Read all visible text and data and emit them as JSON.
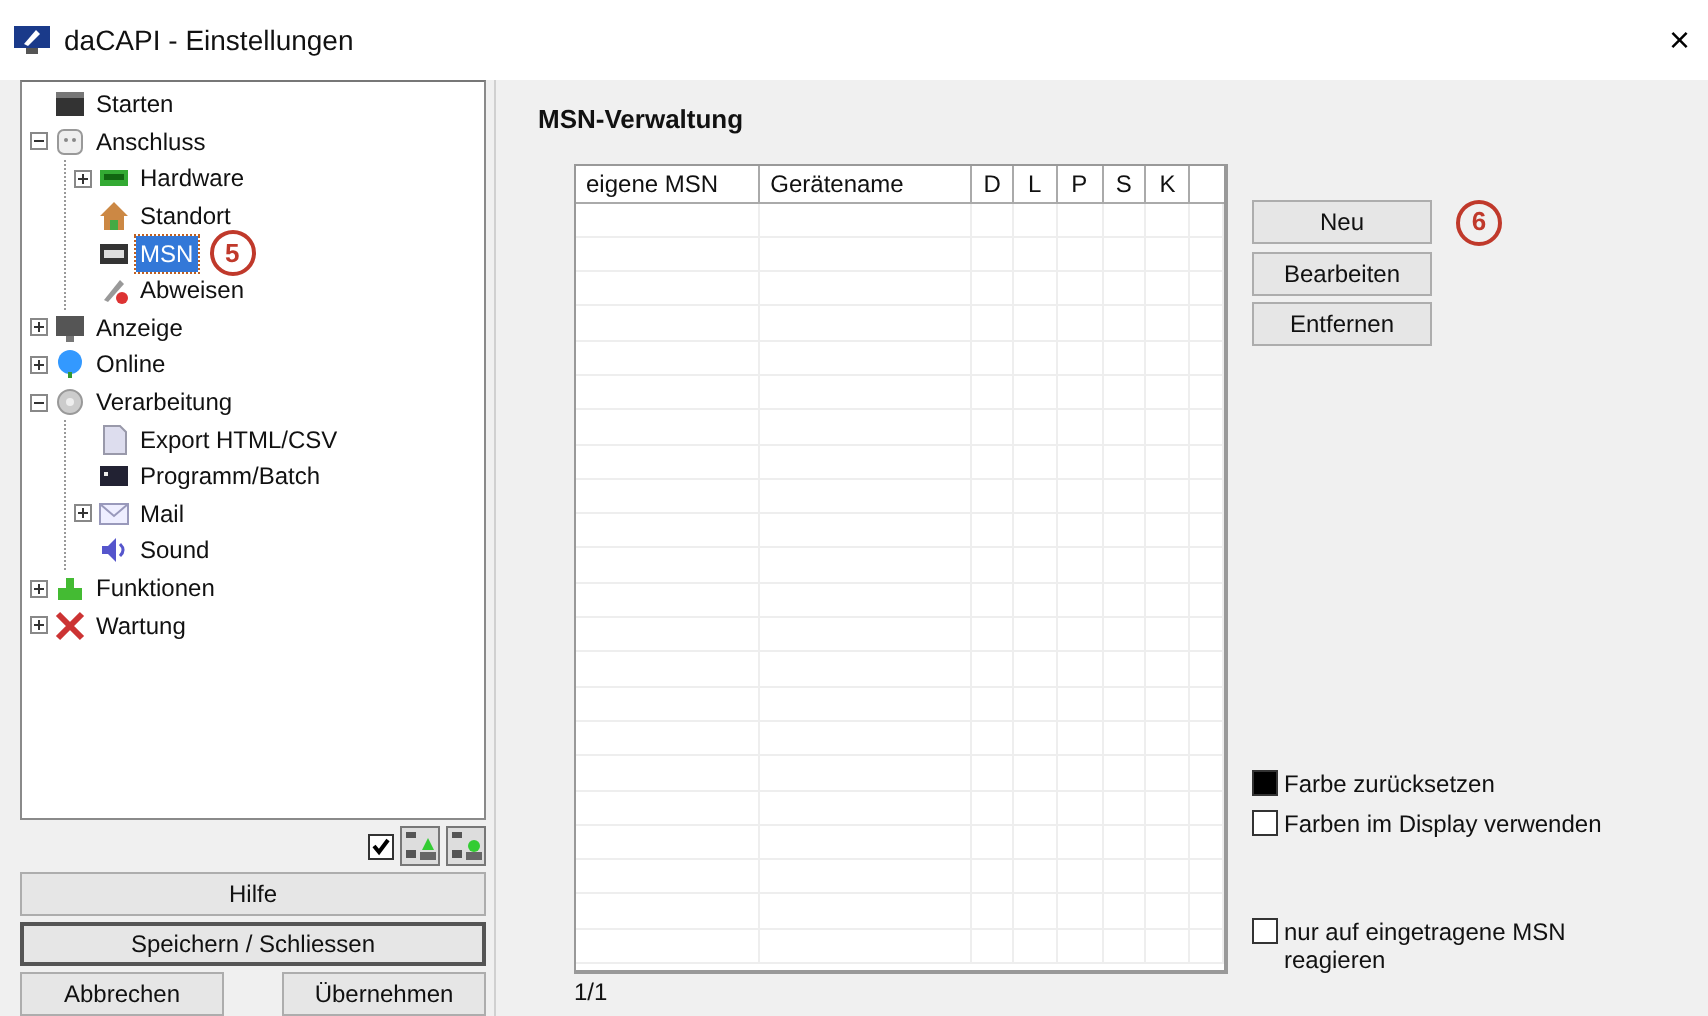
{
  "window": {
    "title": "daCAPI - Einstellungen",
    "close": "×"
  },
  "tree": [
    {
      "label": "Starten",
      "selected": false
    },
    {
      "label": "Anschluss",
      "selected": false,
      "expanded": true,
      "children": [
        {
          "label": "Hardware",
          "selected": false,
          "expanded": false
        },
        {
          "label": "Standort",
          "selected": false
        },
        {
          "label": "MSN",
          "selected": true,
          "callout": "5"
        },
        {
          "label": "Abweisen",
          "selected": false
        }
      ]
    },
    {
      "label": "Anzeige",
      "selected": false,
      "expanded": false
    },
    {
      "label": "Online",
      "selected": false,
      "expanded": false
    },
    {
      "label": "Verarbeitung",
      "selected": false,
      "expanded": true,
      "children": [
        {
          "label": "Export HTML/CSV",
          "selected": false
        },
        {
          "label": "Programm/Batch",
          "selected": false
        },
        {
          "label": "Mail",
          "selected": false,
          "expanded": false
        },
        {
          "label": "Sound",
          "selected": false
        }
      ]
    },
    {
      "label": "Funktionen",
      "selected": false,
      "expanded": false
    },
    {
      "label": "Wartung",
      "selected": false,
      "expanded": false
    }
  ],
  "tree_toolbar": {
    "checked": true
  },
  "left_buttons": [
    {
      "label": "Hilfe",
      "default": false
    },
    {
      "label": "Speichern / Schliessen",
      "default": true
    }
  ],
  "bottom_buttons": [
    "Abbrechen",
    "Übernehmen"
  ],
  "section_title": "MSN-Verwaltung",
  "table": {
    "columns": [
      "eigene MSN",
      "Gerätename",
      "D",
      "L",
      "P",
      "S",
      "K"
    ],
    "pager": "1/1"
  },
  "action_buttons": [
    {
      "label": "Neu",
      "callout": "6"
    },
    {
      "label": "Bearbeiten"
    },
    {
      "label": "Entfernen"
    }
  ],
  "options": [
    {
      "kind": "swatch",
      "label": "Farbe zurücksetzen"
    },
    {
      "kind": "checkbox",
      "label": "Farben im Display verwenden",
      "checked": false
    },
    {
      "kind": "checkbox",
      "label": "nur auf eingetragene MSN reagieren",
      "checked": false
    }
  ]
}
